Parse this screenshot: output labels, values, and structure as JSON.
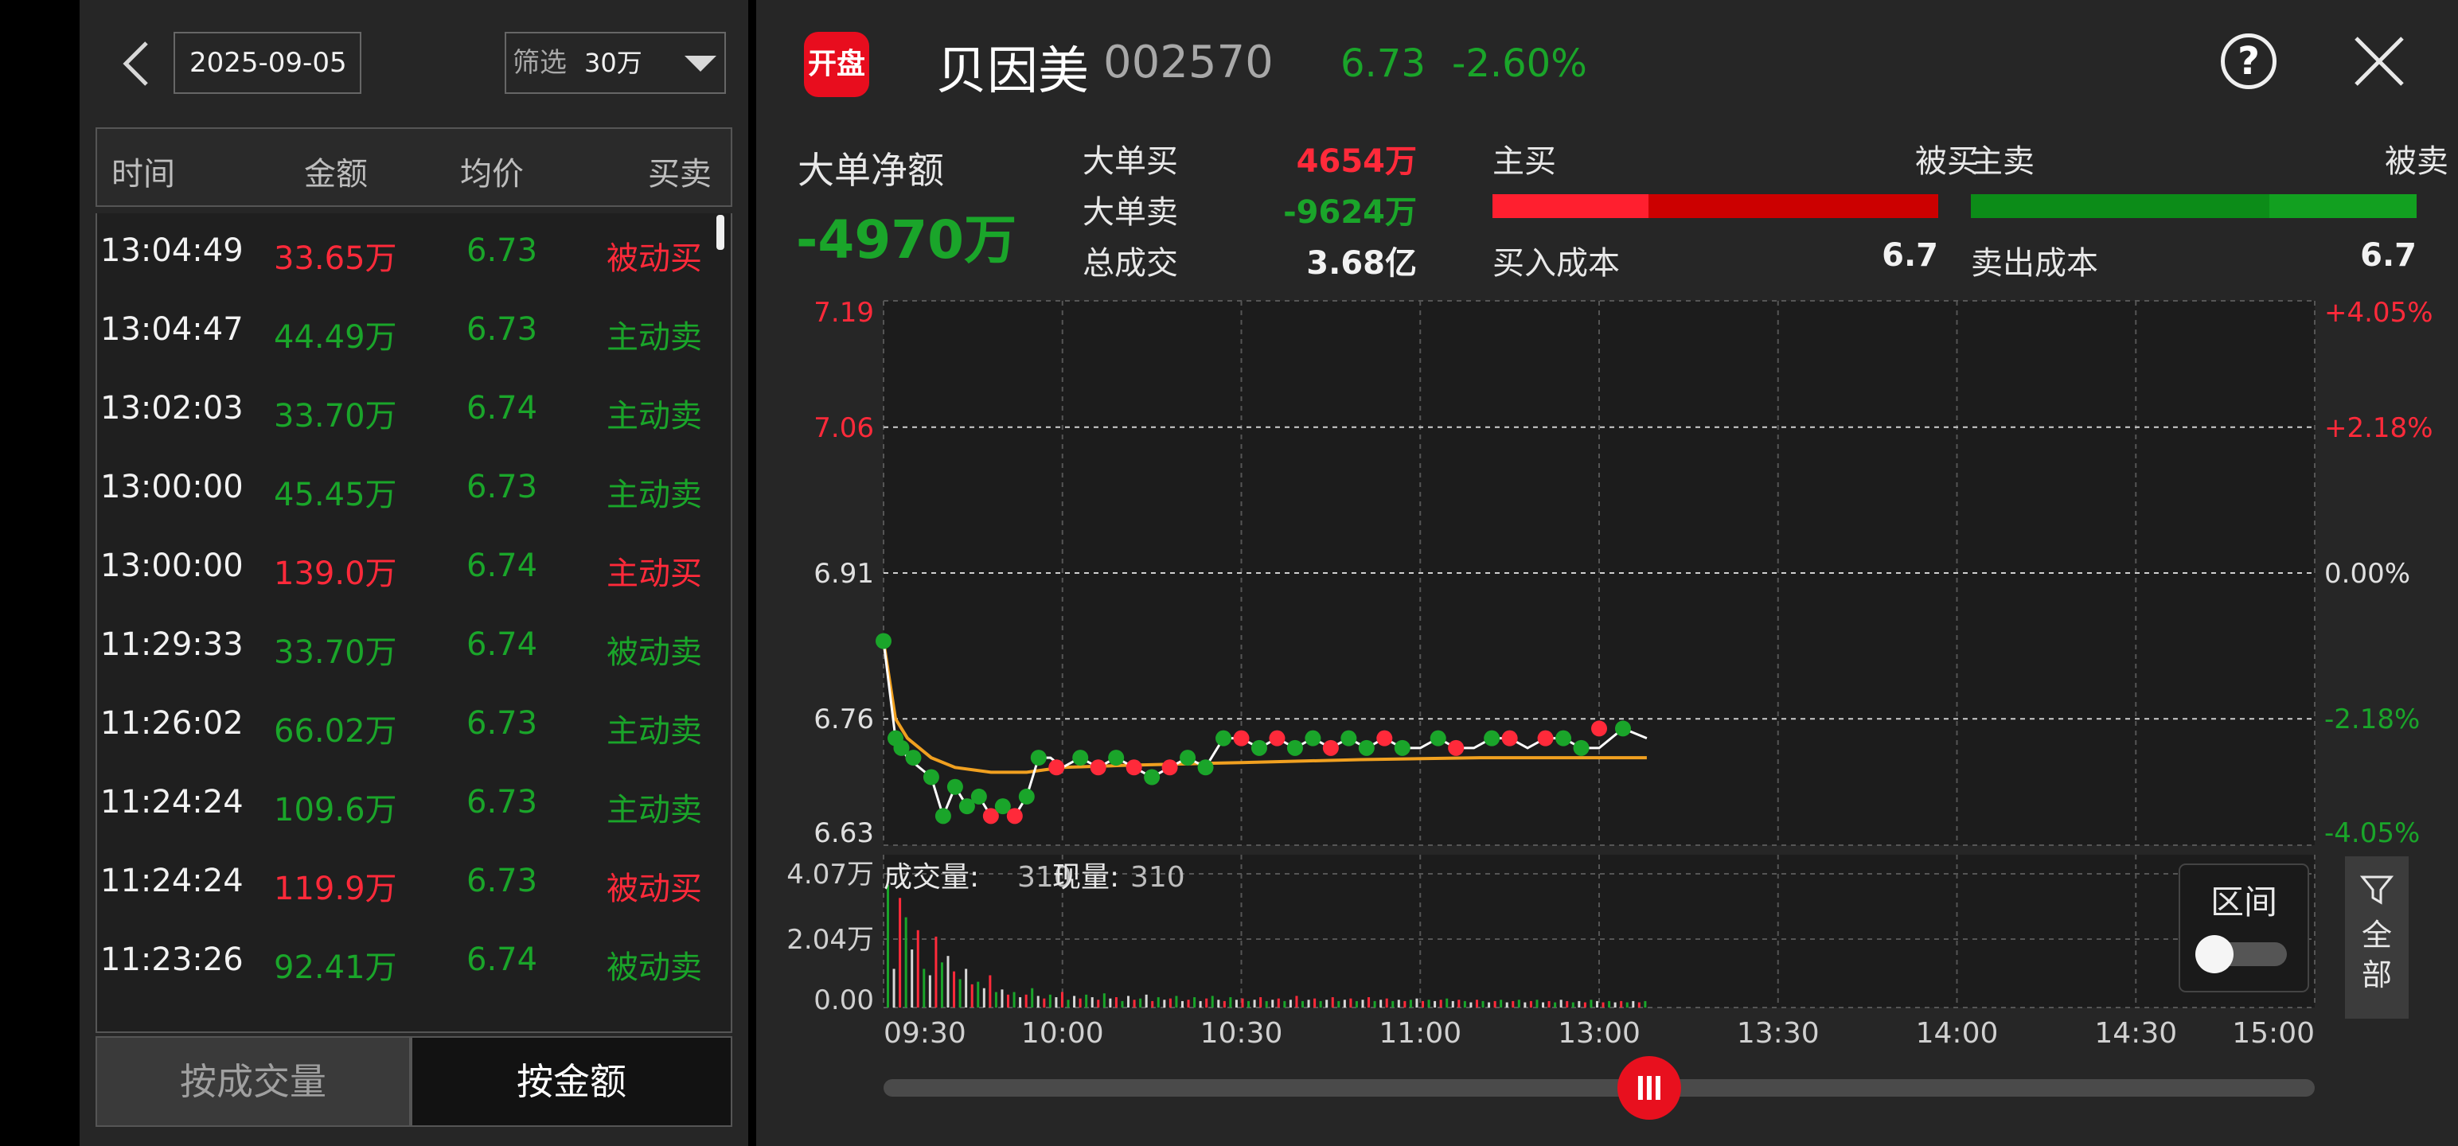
{
  "colors": {
    "red": "#ff2a3a",
    "green": "#1aa52a",
    "bg": "#262626",
    "orange": "#f0a020"
  },
  "left_panel": {
    "back_icon": "chevron-left-icon",
    "date": "2025-09-05",
    "filter_label": "筛选",
    "filter_value": "30万",
    "headers": {
      "time": "时间",
      "amount": "金额",
      "avg_price": "均价",
      "side": "买卖"
    },
    "rows": [
      {
        "time": "13:04:49",
        "amount": "33.65万",
        "price": "6.73",
        "side": "被动买",
        "amount_color": "red",
        "price_color": "green",
        "side_color": "red"
      },
      {
        "time": "13:04:47",
        "amount": "44.49万",
        "price": "6.73",
        "side": "主动卖",
        "amount_color": "green",
        "price_color": "green",
        "side_color": "green"
      },
      {
        "time": "13:02:03",
        "amount": "33.70万",
        "price": "6.74",
        "side": "主动卖",
        "amount_color": "green",
        "price_color": "green",
        "side_color": "green"
      },
      {
        "time": "13:00:00",
        "amount": "45.45万",
        "price": "6.73",
        "side": "主动卖",
        "amount_color": "green",
        "price_color": "green",
        "side_color": "green"
      },
      {
        "time": "13:00:00",
        "amount": "139.0万",
        "price": "6.74",
        "side": "主动买",
        "amount_color": "red",
        "price_color": "green",
        "side_color": "red"
      },
      {
        "time": "11:29:33",
        "amount": "33.70万",
        "price": "6.74",
        "side": "被动卖",
        "amount_color": "green",
        "price_color": "green",
        "side_color": "green"
      },
      {
        "time": "11:26:02",
        "amount": "66.02万",
        "price": "6.73",
        "side": "主动卖",
        "amount_color": "green",
        "price_color": "green",
        "side_color": "green"
      },
      {
        "time": "11:24:24",
        "amount": "109.6万",
        "price": "6.73",
        "side": "主动卖",
        "amount_color": "green",
        "price_color": "green",
        "side_color": "green"
      },
      {
        "time": "11:24:24",
        "amount": "119.9万",
        "price": "6.73",
        "side": "被动买",
        "amount_color": "red",
        "price_color": "green",
        "side_color": "red"
      },
      {
        "time": "11:23:26",
        "amount": "92.41万",
        "price": "6.74",
        "side": "被动卖",
        "amount_color": "green",
        "price_color": "green",
        "side_color": "green"
      }
    ],
    "btn_by_volume": "按成交量",
    "btn_by_amount": "按金额"
  },
  "header": {
    "logo_text": "开盘",
    "name": "贝因美",
    "code": "002570",
    "price": "6.73",
    "change": "-2.60%",
    "help_icon": "help-circle-icon",
    "help_text": "?",
    "close_icon": "close-icon"
  },
  "summary": {
    "net_label": "大单净额",
    "net_value": "-4970万",
    "big_buy_label": "大单买",
    "big_buy_value": "4654万",
    "big_sell_label": "大单卖",
    "big_sell_value": "-9624万",
    "total_label": "总成交",
    "total_value": "3.68亿",
    "active_buy": "主买",
    "passive_buy": "被买",
    "active_sell": "主卖",
    "passive_sell": "被卖",
    "buy_cost_label": "买入成本",
    "buy_cost": "6.7",
    "sell_cost_label": "卖出成本",
    "sell_cost": "6.7",
    "active_buy_ratio": 0.35,
    "active_sell_ratio": 0.67
  },
  "chart_data": {
    "type": "line",
    "y_ticks_left": [
      "7.19",
      "7.06",
      "6.91",
      "6.76",
      "6.63"
    ],
    "y_ticks_right": [
      "+4.05%",
      "+2.18%",
      "0.00%",
      "-2.18%",
      "-4.05%"
    ],
    "ylim": [
      6.63,
      7.19
    ],
    "x_ticks": [
      "09:30",
      "10:00",
      "10:30",
      "11:00",
      "13:00",
      "13:30",
      "14:00",
      "14:30",
      "15:00"
    ],
    "grid": true,
    "price_series": {
      "name": "",
      "x": [
        0,
        2,
        4,
        6,
        8,
        10,
        12,
        14,
        16,
        18,
        20,
        22,
        24,
        26,
        28,
        30,
        33,
        36,
        39,
        42,
        45,
        48,
        51,
        54,
        57,
        60,
        63,
        66,
        69,
        72,
        75,
        78,
        81,
        84,
        87,
        90,
        93,
        96,
        99,
        102,
        105,
        108,
        111,
        114,
        117,
        120,
        124,
        128
      ],
      "values": [
        6.84,
        6.74,
        6.72,
        6.71,
        6.7,
        6.66,
        6.69,
        6.67,
        6.68,
        6.66,
        6.67,
        6.66,
        6.68,
        6.72,
        6.72,
        6.71,
        6.72,
        6.71,
        6.72,
        6.71,
        6.7,
        6.71,
        6.72,
        6.71,
        6.74,
        6.74,
        6.73,
        6.74,
        6.73,
        6.74,
        6.73,
        6.74,
        6.73,
        6.74,
        6.73,
        6.73,
        6.74,
        6.73,
        6.73,
        6.74,
        6.74,
        6.73,
        6.74,
        6.74,
        6.73,
        6.73,
        6.75,
        6.74
      ]
    },
    "avg_series": {
      "name": "",
      "x": [
        0,
        2,
        4,
        8,
        12,
        18,
        24,
        30,
        40,
        60,
        80,
        100,
        128
      ],
      "values": [
        6.84,
        6.76,
        6.74,
        6.72,
        6.71,
        6.705,
        6.705,
        6.71,
        6.712,
        6.715,
        6.718,
        6.72,
        6.72
      ]
    },
    "markers": [
      {
        "x": 0,
        "y": 6.84,
        "c": "green"
      },
      {
        "x": 2,
        "y": 6.74,
        "c": "green"
      },
      {
        "x": 3,
        "y": 6.73,
        "c": "green"
      },
      {
        "x": 5,
        "y": 6.72,
        "c": "green"
      },
      {
        "x": 8,
        "y": 6.7,
        "c": "green"
      },
      {
        "x": 10,
        "y": 6.66,
        "c": "green"
      },
      {
        "x": 12,
        "y": 6.69,
        "c": "green"
      },
      {
        "x": 14,
        "y": 6.67,
        "c": "green"
      },
      {
        "x": 16,
        "y": 6.68,
        "c": "green"
      },
      {
        "x": 18,
        "y": 6.66,
        "c": "red"
      },
      {
        "x": 20,
        "y": 6.67,
        "c": "green"
      },
      {
        "x": 22,
        "y": 6.66,
        "c": "red"
      },
      {
        "x": 24,
        "y": 6.68,
        "c": "green"
      },
      {
        "x": 26,
        "y": 6.72,
        "c": "green"
      },
      {
        "x": 29,
        "y": 6.71,
        "c": "red"
      },
      {
        "x": 33,
        "y": 6.72,
        "c": "green"
      },
      {
        "x": 36,
        "y": 6.71,
        "c": "red"
      },
      {
        "x": 39,
        "y": 6.72,
        "c": "green"
      },
      {
        "x": 42,
        "y": 6.71,
        "c": "red"
      },
      {
        "x": 45,
        "y": 6.7,
        "c": "green"
      },
      {
        "x": 48,
        "y": 6.71,
        "c": "red"
      },
      {
        "x": 51,
        "y": 6.72,
        "c": "green"
      },
      {
        "x": 54,
        "y": 6.71,
        "c": "green"
      },
      {
        "x": 57,
        "y": 6.74,
        "c": "green"
      },
      {
        "x": 60,
        "y": 6.74,
        "c": "red"
      },
      {
        "x": 63,
        "y": 6.73,
        "c": "green"
      },
      {
        "x": 66,
        "y": 6.74,
        "c": "red"
      },
      {
        "x": 69,
        "y": 6.73,
        "c": "green"
      },
      {
        "x": 72,
        "y": 6.74,
        "c": "green"
      },
      {
        "x": 75,
        "y": 6.73,
        "c": "red"
      },
      {
        "x": 78,
        "y": 6.74,
        "c": "green"
      },
      {
        "x": 81,
        "y": 6.73,
        "c": "green"
      },
      {
        "x": 84,
        "y": 6.74,
        "c": "red"
      },
      {
        "x": 87,
        "y": 6.73,
        "c": "green"
      },
      {
        "x": 93,
        "y": 6.74,
        "c": "green"
      },
      {
        "x": 96,
        "y": 6.73,
        "c": "red"
      },
      {
        "x": 102,
        "y": 6.74,
        "c": "green"
      },
      {
        "x": 105,
        "y": 6.74,
        "c": "red"
      },
      {
        "x": 111,
        "y": 6.74,
        "c": "red"
      },
      {
        "x": 114,
        "y": 6.74,
        "c": "green"
      },
      {
        "x": 117,
        "y": 6.73,
        "c": "green"
      },
      {
        "x": 120,
        "y": 6.75,
        "c": "red"
      },
      {
        "x": 124,
        "y": 6.75,
        "c": "green"
      }
    ],
    "volume_ticks": [
      "4.07万",
      "2.04万",
      "0.00"
    ],
    "volume_label": "成交量:",
    "volume_value": "310",
    "current_label": "现量:",
    "current_value": "310",
    "volume_bars": [
      0.95,
      0.3,
      0.85,
      0.7,
      0.45,
      0.6,
      0.3,
      0.25,
      0.55,
      0.35,
      0.4,
      0.28,
      0.22,
      0.3,
      0.18,
      0.2,
      0.15,
      0.25,
      0.12,
      0.14,
      0.1,
      0.12,
      0.08,
      0.1,
      0.15,
      0.09,
      0.07,
      0.1,
      0.08,
      0.12,
      0.06,
      0.09,
      0.07,
      0.1,
      0.08,
      0.06,
      0.11,
      0.07,
      0.08,
      0.05,
      0.09,
      0.06,
      0.07,
      0.1,
      0.05,
      0.08,
      0.06,
      0.07,
      0.09,
      0.05,
      0.06,
      0.08,
      0.05,
      0.07,
      0.09,
      0.06,
      0.05,
      0.08,
      0.06,
      0.07,
      0.05,
      0.06,
      0.08,
      0.05,
      0.06,
      0.07,
      0.05,
      0.06,
      0.09,
      0.05,
      0.06,
      0.07,
      0.05,
      0.06,
      0.08,
      0.05,
      0.06,
      0.07,
      0.05,
      0.06,
      0.08,
      0.05,
      0.06,
      0.07,
      0.05,
      0.06,
      0.05,
      0.06,
      0.07,
      0.05,
      0.06,
      0.05,
      0.06,
      0.07,
      0.05,
      0.06,
      0.05,
      0.04,
      0.06,
      0.05,
      0.04,
      0.05,
      0.06,
      0.04,
      0.05,
      0.06,
      0.04,
      0.05,
      0.06,
      0.04,
      0.05,
      0.04,
      0.06,
      0.05,
      0.04,
      0.05,
      0.04,
      0.06,
      0.05,
      0.04,
      0.05,
      0.04,
      0.05,
      0.04,
      0.05,
      0.04,
      0.05
    ],
    "x_max_minutes": 240,
    "elapsed_minutes": 128
  },
  "range_panel": {
    "label": "区间",
    "toggle_on": false
  },
  "filter_all": {
    "icon": "filter-icon",
    "label_1": "全",
    "label_2": "部"
  },
  "slider": {
    "icon": "grip-icon",
    "position_ratio": 0.535
  }
}
